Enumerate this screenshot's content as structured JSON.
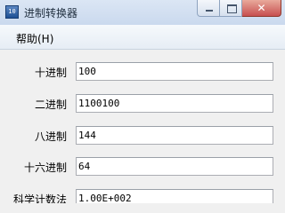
{
  "window": {
    "title": "进制转换器",
    "icon_name": "app-icon",
    "close_glyph": "✕"
  },
  "menu": {
    "help_label": "帮助(H)"
  },
  "fields": [
    {
      "label": "十进制",
      "value": "100"
    },
    {
      "label": "二进制",
      "value": "1100100"
    },
    {
      "label": "八进制",
      "value": "144"
    },
    {
      "label": "十六进制",
      "value": "64"
    },
    {
      "label": "科学计数法",
      "value": "1.00E+002"
    }
  ]
}
